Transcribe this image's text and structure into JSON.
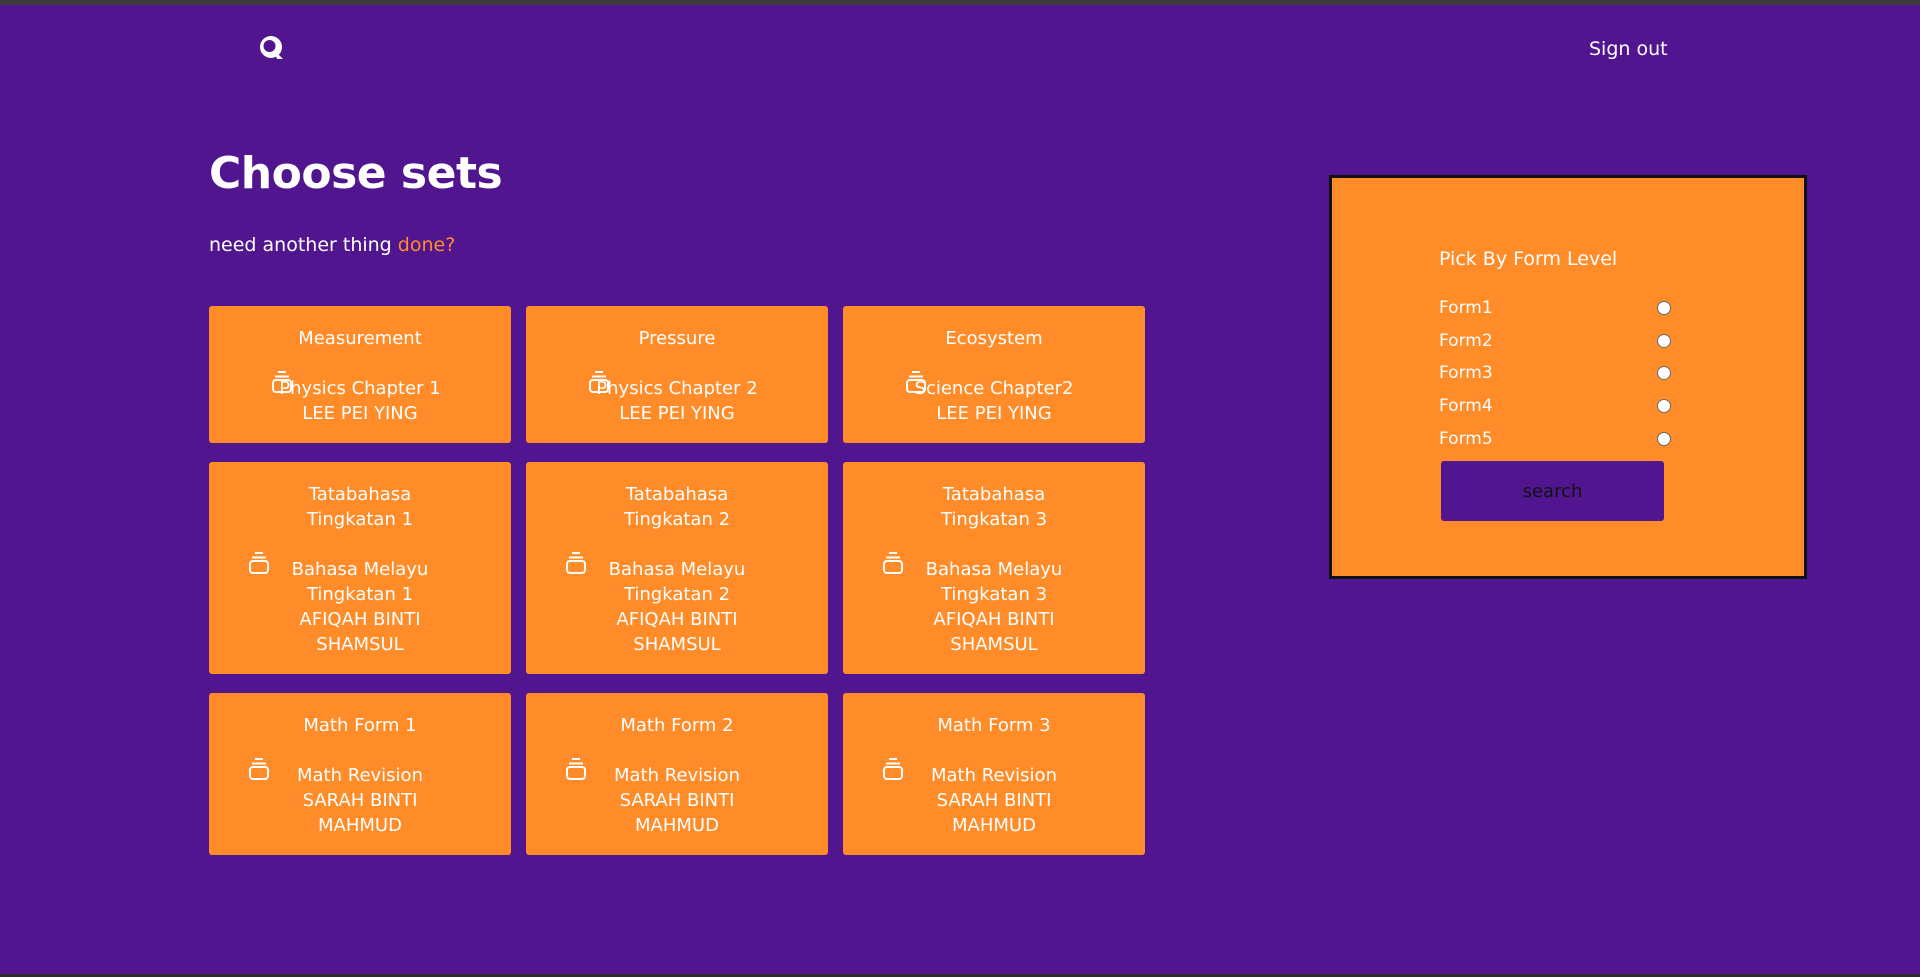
{
  "header": {
    "logo_icon": "quiz-logo-icon",
    "signout_label": "Sign out"
  },
  "main": {
    "title": "Choose sets",
    "subtitle_text": "need another thing",
    "subtitle_link": "done?"
  },
  "colors": {
    "background": "#51168f",
    "accent": "#ff8c28",
    "card": "#ff8c28"
  },
  "cards": [
    {
      "title": [
        "Measurement"
      ],
      "body": [
        "Physics Chapter 1",
        "LEE PEI YING"
      ]
    },
    {
      "title": [
        "Pressure"
      ],
      "body": [
        "Physics Chapter 2",
        "LEE PEI YING"
      ]
    },
    {
      "title": [
        "Ecosystem"
      ],
      "body": [
        "Science Chapter2",
        "LEE PEI YING"
      ]
    },
    {
      "title": [
        "Tatabahasa",
        "Tingkatan 1"
      ],
      "body": [
        "Bahasa Melayu",
        "Tingkatan 1",
        "AFIQAH BINTI",
        "SHAMSUL"
      ]
    },
    {
      "title": [
        "Tatabahasa",
        "Tingkatan 2"
      ],
      "body": [
        "Bahasa Melayu",
        "Tingkatan 2",
        "AFIQAH BINTI",
        "SHAMSUL"
      ]
    },
    {
      "title": [
        "Tatabahasa",
        "Tingkatan 3"
      ],
      "body": [
        "Bahasa Melayu",
        "Tingkatan 3",
        "AFIQAH BINTI",
        "SHAMSUL"
      ]
    },
    {
      "title": [
        "Math Form 1"
      ],
      "body": [
        "Math Revision",
        "SARAH BINTI",
        "MAHMUD"
      ]
    },
    {
      "title": [
        "Math Form 2"
      ],
      "body": [
        "Math Revision",
        "SARAH BINTI",
        "MAHMUD"
      ]
    },
    {
      "title": [
        "Math Form 3"
      ],
      "body": [
        "Math Revision",
        "SARAH BINTI",
        "MAHMUD"
      ]
    }
  ],
  "filter": {
    "title": "Pick By Form Level",
    "options": [
      "Form1",
      "Form2",
      "Form3",
      "Form4",
      "Form5"
    ],
    "search_label": "search"
  }
}
